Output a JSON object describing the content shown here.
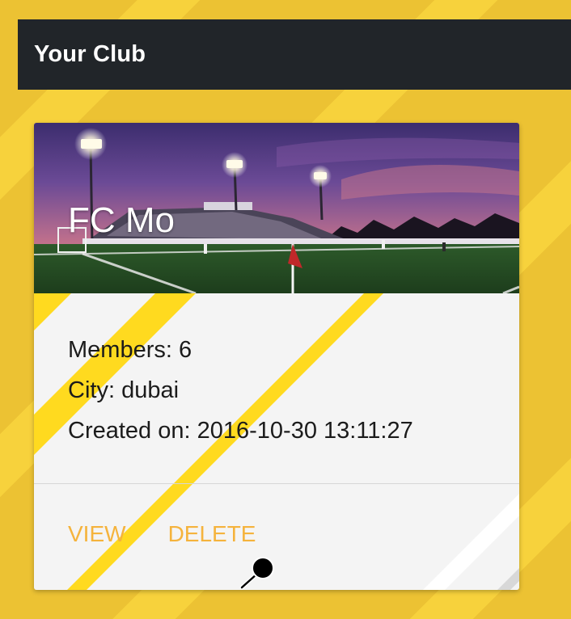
{
  "header": {
    "title": "Your Club"
  },
  "club_card": {
    "name": "FC Mo",
    "image": "stadium-sunset-photo",
    "info": {
      "members_label": "Members:",
      "members_value": "6",
      "city_label": "City:",
      "city_value": "dubai",
      "created_label": "Created on:",
      "created_value": "2016-10-30 13:11:27"
    },
    "actions": {
      "view": "VIEW",
      "delete": "DELETE"
    }
  },
  "colors": {
    "background": "#ECC233",
    "header_bg": "#212529",
    "action": "#F5B33C",
    "stripe": "#FFDA1F"
  }
}
